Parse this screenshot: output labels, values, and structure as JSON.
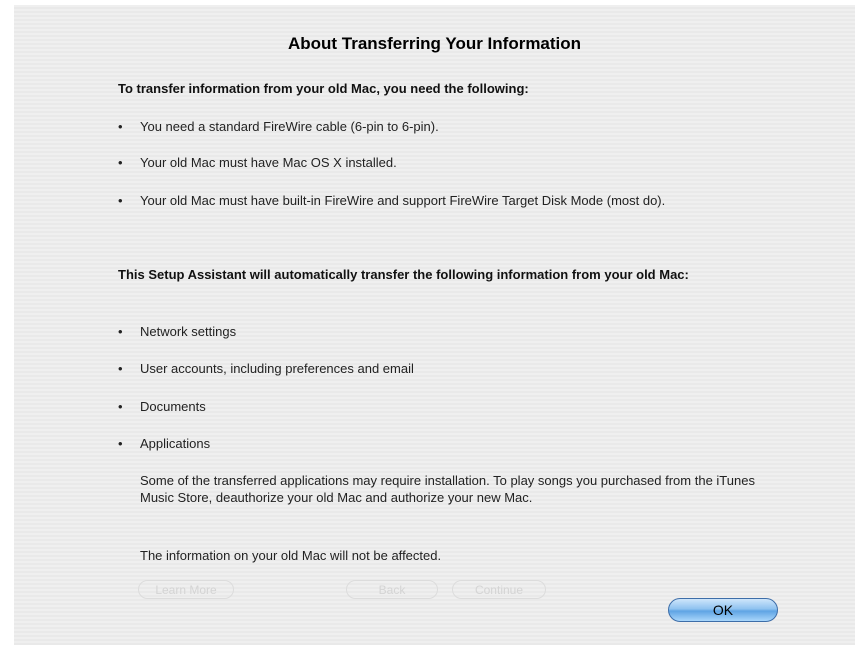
{
  "dialog": {
    "title": "About Transferring Your Information",
    "section1": {
      "heading": "To transfer information from your old Mac, you need the following:",
      "items": [
        "You need a standard FireWire cable (6-pin to 6-pin).",
        "Your old Mac must have Mac OS X installed.",
        "Your old Mac must have built-in FireWire and support FireWire Target Disk Mode (most do)."
      ]
    },
    "section2": {
      "heading": "This Setup Assistant will automatically transfer the following information from your old Mac:",
      "items": [
        "Network settings",
        "User accounts, including preferences and email",
        "Documents",
        "Applications"
      ]
    },
    "note_apps": "Some of the transferred applications may require installation. To play songs you purchased from the iTunes Music Store, deauthorize your old Mac and authorize your new Mac.",
    "note_unaffected": "The information on your old Mac will not be affected.",
    "bullet_char": "•",
    "background_buttons": {
      "learn_more": "Learn More",
      "back": "Back",
      "continue": "Continue"
    },
    "ok_label": "OK"
  },
  "colors": {
    "sheet_background": "#ececec",
    "ok_button_accent": "#5fa4e4"
  }
}
